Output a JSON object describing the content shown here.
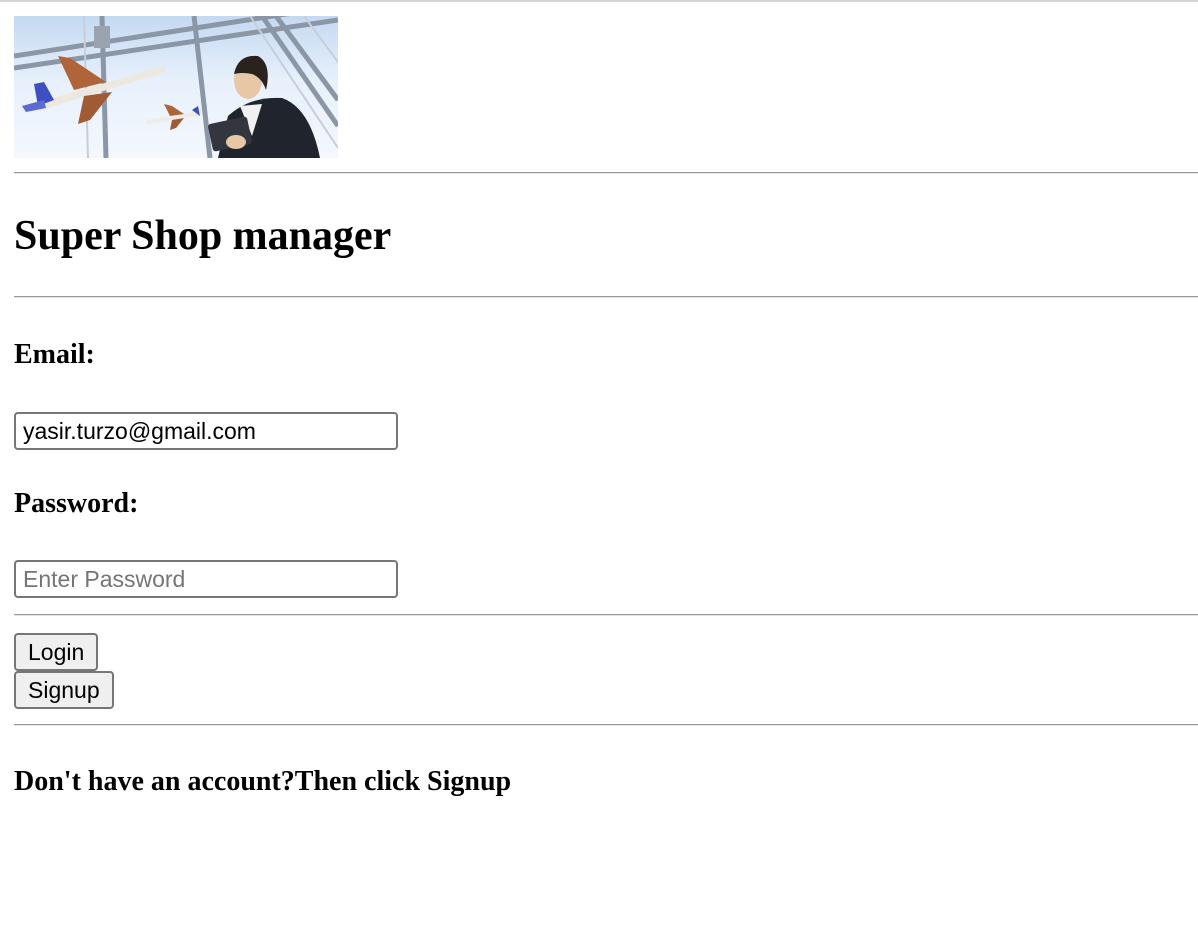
{
  "page": {
    "banner": {
      "icon": "airport-businesswoman-banner-image",
      "colors": {
        "sky": "#c4d9f2",
        "plane_wing": "#b0643a",
        "plane_tail": "#3f4fc2",
        "suit": "#20242c"
      }
    },
    "title": "Super Shop manager",
    "form": {
      "email_label": "Email:",
      "email_value": "yasir.turzo@gmail.com",
      "password_label": "Password:",
      "password_placeholder": "Enter Password",
      "password_value": ""
    },
    "buttons": {
      "login_label": "Login",
      "signup_label": "Signup"
    },
    "footer_text": "Don't have an account?Then click Signup"
  }
}
